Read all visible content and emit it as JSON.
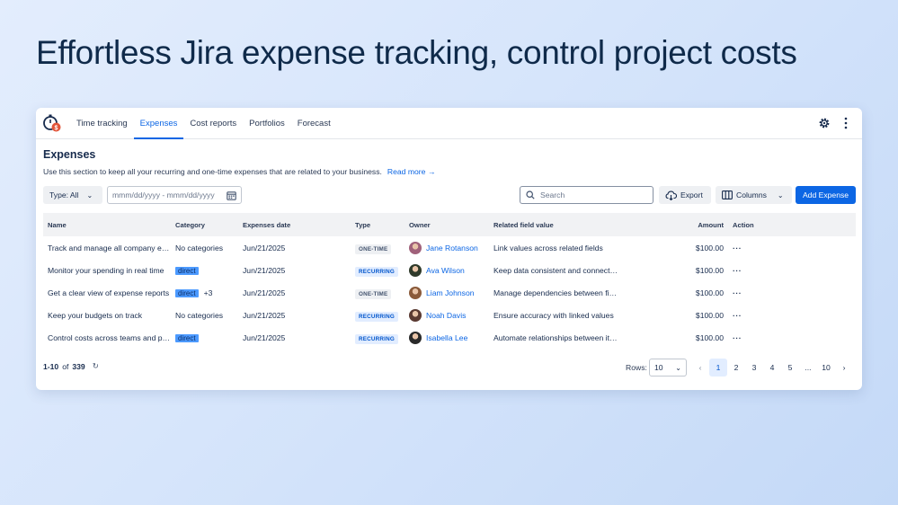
{
  "hero": {
    "title": "Effortless Jira expense tracking, control project costs"
  },
  "nav": {
    "tabs": [
      {
        "label": "Time tracking",
        "active": false
      },
      {
        "label": "Expenses",
        "active": true
      },
      {
        "label": "Cost reports",
        "active": false
      },
      {
        "label": "Portfolios",
        "active": false
      },
      {
        "label": "Forecast",
        "active": false
      }
    ]
  },
  "section": {
    "title": "Expenses",
    "description": "Use this section to keep all your recurring and one-time expenses that are related to your business.",
    "read_more": "Read more"
  },
  "toolbar": {
    "type_filter": "Type: All",
    "date_placeholder": "mmm/dd/yyyy - mmm/dd/yyyy",
    "search_placeholder": "Search",
    "export_label": "Export",
    "columns_label": "Columns",
    "add_label": "Add Expense"
  },
  "table": {
    "headers": {
      "name": "Name",
      "category": "Category",
      "date": "Expenses date",
      "type": "Type",
      "owner": "Owner",
      "related": "Related field value",
      "amount": "Amount",
      "action": "Action"
    },
    "rows": [
      {
        "name": "Track and manage all company expenses",
        "category": "No categories",
        "category_tag": false,
        "extra": "",
        "date": "Jun/21/2025",
        "type": "ONE-TIME",
        "owner": "Jane Rotanson",
        "avatar_color": "#a0617a",
        "related": "Link values across related fields",
        "amount": "$100.00"
      },
      {
        "name": "Monitor your spending in real time",
        "category": "direct",
        "category_tag": true,
        "extra": "",
        "date": "Jun/21/2025",
        "type": "RECURRING",
        "owner": "Ava Wilson",
        "avatar_color": "#2f3a2a",
        "related": "Keep data consistent and connected",
        "amount": "$100.00"
      },
      {
        "name": "Get a clear view of expense reports",
        "category": "direct",
        "category_tag": true,
        "extra": "+3",
        "date": "Jun/21/2025",
        "type": "ONE-TIME",
        "owner": "Liam Johnson",
        "avatar_color": "#8a5a3a",
        "related": "Manage dependencies between fields",
        "amount": "$100.00"
      },
      {
        "name": "Keep your budgets on track",
        "category": "No categories",
        "category_tag": false,
        "extra": "",
        "date": "Jun/21/2025",
        "type": "RECURRING",
        "owner": "Noah Davis",
        "avatar_color": "#5a3a32",
        "related": "Ensure accuracy with linked values",
        "amount": "$100.00"
      },
      {
        "name": "Control costs across teams and projects",
        "category": "direct",
        "category_tag": true,
        "extra": "",
        "date": "Jun/21/2025",
        "type": "RECURRING",
        "owner": "Isabella Lee",
        "avatar_color": "#2a2a2a",
        "related": "Automate relationships between items",
        "amount": "$100.00"
      }
    ]
  },
  "footer": {
    "range": "1-10",
    "of": "of",
    "total": "339",
    "rows_label": "Rows:",
    "rows_value": "10",
    "pages": [
      "1",
      "2",
      "3",
      "4",
      "5",
      "...",
      "10"
    ],
    "active_page": "1"
  },
  "colors": {
    "accent": "#0c66e4",
    "tag": "#4c9aff",
    "logo_badge": "#e2553a"
  }
}
